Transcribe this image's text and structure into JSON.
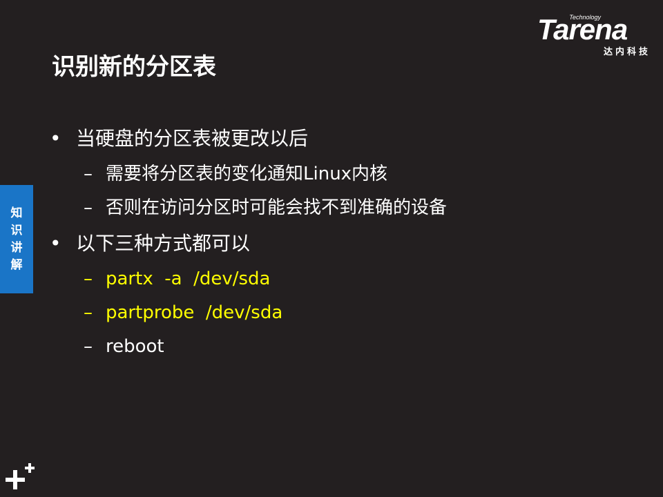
{
  "logo": {
    "tagline": "Technology",
    "wordmark": "Tarena",
    "chinese": "达内科技"
  },
  "title": "识别新的分区表",
  "side_tab": [
    "知",
    "识",
    "讲",
    "解"
  ],
  "bullets": [
    {
      "text": "当硬盘的分区表被更改以后",
      "sub": [
        {
          "text": "需要将分区表的变化通知Linux内核",
          "color": "#ffffff"
        },
        {
          "text": "否则在访问分区时可能会找不到准确的设备",
          "color": "#ffffff"
        }
      ]
    },
    {
      "text": "以下三种方式都可以",
      "sub": [
        {
          "text": "partx  -a  /dev/sda",
          "color": "#ffff00"
        },
        {
          "text": "partprobe  /dev/sda",
          "color": "#ffff00"
        },
        {
          "text": "reboot",
          "color": "#ffffff"
        }
      ]
    }
  ],
  "bullet_glyph": "•",
  "dash_glyph": "–",
  "corner_icon": "plus-plus-icon",
  "colors": {
    "background": "#231f20",
    "accent_blue": "#1a75c7",
    "highlight": "#ffff00"
  }
}
